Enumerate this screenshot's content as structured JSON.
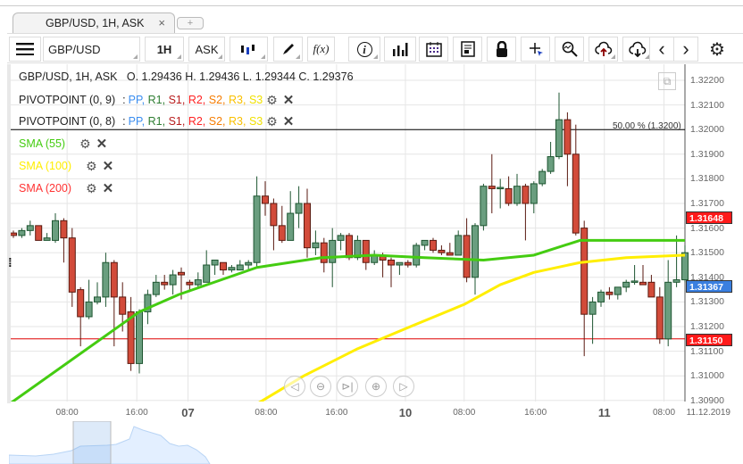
{
  "tab": {
    "title": "GBP/USD, 1H, ASK",
    "close": "×",
    "add": "+"
  },
  "toolbar": {
    "menu": "menu-icon",
    "symbol": "GBP/USD",
    "timeframe": "1H",
    "side": "ASK",
    "fx": "f(x)",
    "info": "i",
    "prev": "‹",
    "next": "›"
  },
  "legend": {
    "ohlc": "GBP/USD, 1H, ASK   O. 1.29436 H. 1.29436 L. 1.29344 C. 1.29376",
    "pivot1": "PIVOTPOINT (0, 9)",
    "pivot2": "PIVOTPOINT (0, 8)",
    "pivot_items": [
      {
        "t": "PP",
        "c": "#3b8ef0"
      },
      {
        "t": "R1",
        "c": "#2e7d32"
      },
      {
        "t": "S1",
        "c": "#b71c1c"
      },
      {
        "t": "R2",
        "c": "#f22"
      },
      {
        "t": "S2",
        "c": "#f57c00"
      },
      {
        "t": "R3",
        "c": "#f9c000"
      },
      {
        "t": "S3",
        "c": "#f0e000"
      }
    ],
    "sma55": "SMA (55)",
    "sma100": "SMA (100)",
    "sma200": "SMA (200)"
  },
  "colors": {
    "sma55": "#44cc11",
    "sma100": "#ffee00",
    "sma200": "#ff3333",
    "up": "#6a9e7f",
    "down": "#d24b3a",
    "bid": "#3a7fe0"
  },
  "annotation": "50.00 % (1.3200)",
  "price_labels": {
    "high": "1.31648",
    "bid": "1.31367",
    "low": "1.31150"
  },
  "chart_data": {
    "type": "candlestick",
    "ylim": [
      1.309,
      1.3225
    ],
    "yticks": [
      "1.32200",
      "1.32100",
      "1.32000",
      "1.31900",
      "1.31800",
      "1.31700",
      "1.31600",
      "1.31500",
      "1.31400",
      "1.31300",
      "1.31200",
      "1.31100",
      "1.31000",
      "1.30900"
    ],
    "xticks": [
      {
        "l": "08:00",
        "i": 6.4,
        "day": false
      },
      {
        "l": "16:00",
        "i": 14.7,
        "day": false
      },
      {
        "l": "07",
        "i": 20.8,
        "day": true
      },
      {
        "l": "08:00",
        "i": 30.1,
        "day": false
      },
      {
        "l": "16:00",
        "i": 38.5,
        "day": false
      },
      {
        "l": "10",
        "i": 46.7,
        "day": true
      },
      {
        "l": "08:00",
        "i": 53.7,
        "day": false
      },
      {
        "l": "16:00",
        "i": 62.2,
        "day": false
      },
      {
        "l": "11",
        "i": 70.4,
        "day": true
      },
      {
        "l": "08:00",
        "i": 77.5,
        "day": false
      },
      {
        "l": "11.12.2019",
        "i": 82.8,
        "day": false
      }
    ],
    "hlines": [
      {
        "price": 1.32,
        "color": "#000"
      },
      {
        "price": 1.3115,
        "color": "#d00"
      }
    ],
    "candles": [
      [
        1.3158,
        1.3159,
        1.3156,
        1.3157
      ],
      [
        1.3157,
        1.316,
        1.3156,
        1.3159
      ],
      [
        1.3159,
        1.3163,
        1.3157,
        1.3161
      ],
      [
        1.3161,
        1.3161,
        1.3155,
        1.3155
      ],
      [
        1.3155,
        1.3158,
        1.3155,
        1.3156
      ],
      [
        1.3155,
        1.3166,
        1.3154,
        1.3163
      ],
      [
        1.3163,
        1.3164,
        1.3146,
        1.3156
      ],
      [
        1.3156,
        1.316,
        1.3128,
        1.3134
      ],
      [
        1.3135,
        1.3136,
        1.3112,
        1.3124
      ],
      [
        1.3124,
        1.3139,
        1.3123,
        1.313
      ],
      [
        1.313,
        1.3138,
        1.3129,
        1.3132
      ],
      [
        1.3132,
        1.315,
        1.3128,
        1.3146
      ],
      [
        1.3146,
        1.3147,
        1.3112,
        1.3132
      ],
      [
        1.3132,
        1.3138,
        1.3118,
        1.3125
      ],
      [
        1.3126,
        1.3132,
        1.3102,
        1.3105
      ],
      [
        1.3105,
        1.3127,
        1.3101,
        1.3126
      ],
      [
        1.3126,
        1.3135,
        1.3121,
        1.3133
      ],
      [
        1.3133,
        1.3141,
        1.3132,
        1.3138
      ],
      [
        1.3138,
        1.3141,
        1.3135,
        1.3137
      ],
      [
        1.3137,
        1.3143,
        1.3133,
        1.3141
      ],
      [
        1.3142,
        1.3144,
        1.3131,
        1.3141
      ],
      [
        1.3138,
        1.3139,
        1.3134,
        1.3137
      ],
      [
        1.3137,
        1.3142,
        1.3136,
        1.3139
      ],
      [
        1.3138,
        1.3151,
        1.3138,
        1.3145
      ],
      [
        1.3145,
        1.3147,
        1.3141,
        1.3147
      ],
      [
        1.3146,
        1.3146,
        1.3141,
        1.3143
      ],
      [
        1.3143,
        1.3145,
        1.3142,
        1.3144
      ],
      [
        1.3143,
        1.3147,
        1.3143,
        1.3145
      ],
      [
        1.3145,
        1.3147,
        1.3143,
        1.3146
      ],
      [
        1.3146,
        1.3181,
        1.3144,
        1.3173
      ],
      [
        1.3173,
        1.3179,
        1.3165,
        1.317
      ],
      [
        1.317,
        1.3172,
        1.3151,
        1.3161
      ],
      [
        1.3161,
        1.3169,
        1.3154,
        1.3155
      ],
      [
        1.3155,
        1.3175,
        1.3155,
        1.3166
      ],
      [
        1.3166,
        1.3177,
        1.316,
        1.317
      ],
      [
        1.317,
        1.3176,
        1.3148,
        1.3152
      ],
      [
        1.3152,
        1.3159,
        1.3149,
        1.3154
      ],
      [
        1.3154,
        1.3156,
        1.3142,
        1.3146
      ],
      [
        1.3146,
        1.316,
        1.3136,
        1.3155
      ],
      [
        1.3155,
        1.3158,
        1.3151,
        1.3157
      ],
      [
        1.3157,
        1.3158,
        1.3147,
        1.3148
      ],
      [
        1.3148,
        1.3157,
        1.3147,
        1.3155
      ],
      [
        1.3155,
        1.3155,
        1.3143,
        1.3146
      ],
      [
        1.3146,
        1.3151,
        1.3145,
        1.3149
      ],
      [
        1.3149,
        1.315,
        1.314,
        1.3147
      ],
      [
        1.3147,
        1.3148,
        1.3136,
        1.3145
      ],
      [
        1.3145,
        1.3146,
        1.3141,
        1.3146
      ],
      [
        1.3146,
        1.3147,
        1.3144,
        1.3145
      ],
      [
        1.3145,
        1.3154,
        1.3144,
        1.3153
      ],
      [
        1.3153,
        1.3155,
        1.3151,
        1.3155
      ],
      [
        1.3155,
        1.3156,
        1.315,
        1.3151
      ],
      [
        1.3151,
        1.3153,
        1.3149,
        1.315
      ],
      [
        1.315,
        1.3154,
        1.3149,
        1.3149
      ],
      [
        1.3149,
        1.3159,
        1.3149,
        1.3157
      ],
      [
        1.3157,
        1.3164,
        1.3138,
        1.314
      ],
      [
        1.314,
        1.3162,
        1.3133,
        1.3161
      ],
      [
        1.3161,
        1.3178,
        1.3159,
        1.3177
      ],
      [
        1.3177,
        1.319,
        1.3166,
        1.3176
      ],
      [
        1.3176,
        1.318,
        1.3168,
        1.31765
      ],
      [
        1.3176,
        1.3181,
        1.3169,
        1.317
      ],
      [
        1.317,
        1.3182,
        1.3169,
        1.3177
      ],
      [
        1.3177,
        1.3178,
        1.3155,
        1.317
      ],
      [
        1.317,
        1.3179,
        1.3166,
        1.3178
      ],
      [
        1.3178,
        1.3184,
        1.3177,
        1.3183
      ],
      [
        1.3183,
        1.3195,
        1.3182,
        1.3189
      ],
      [
        1.3189,
        1.3215,
        1.3188,
        1.3204
      ],
      [
        1.3204,
        1.3207,
        1.3177,
        1.319
      ],
      [
        1.319,
        1.3202,
        1.3157,
        1.3158
      ],
      [
        1.316,
        1.3163,
        1.3108,
        1.3125
      ],
      [
        1.3125,
        1.3132,
        1.3113,
        1.313
      ],
      [
        1.313,
        1.3135,
        1.3128,
        1.3134
      ],
      [
        1.3134,
        1.3136,
        1.3131,
        1.3133
      ],
      [
        1.3133,
        1.3136,
        1.3131,
        1.3136
      ],
      [
        1.3136,
        1.3139,
        1.3134,
        1.3138
      ],
      [
        1.3138,
        1.3145,
        1.3137,
        1.31385
      ],
      [
        1.3138,
        1.3145,
        1.3137,
        1.3137
      ],
      [
        1.3138,
        1.3141,
        1.3132,
        1.3132
      ],
      [
        1.3132,
        1.3136,
        1.3113,
        1.3115
      ],
      [
        1.3115,
        1.3147,
        1.3112,
        1.3138
      ],
      [
        1.3138,
        1.3157,
        1.3136,
        1.3139
      ],
      [
        1.3139,
        1.3153,
        1.3138,
        1.315
      ]
    ],
    "sma55": [
      [
        -0.3,
        1.3089
      ],
      [
        15,
        1.3126
      ],
      [
        19.7,
        1.3133
      ],
      [
        29,
        1.3144
      ],
      [
        36.7,
        1.3148
      ],
      [
        43,
        1.3149
      ],
      [
        49,
        1.3148
      ],
      [
        56,
        1.3147
      ],
      [
        62,
        1.3149
      ],
      [
        67.5,
        1.3155
      ],
      [
        73,
        1.3155
      ],
      [
        78,
        1.3155
      ],
      [
        80.3,
        1.3155
      ]
    ],
    "sma100": [
      [
        29.2,
        1.3089
      ],
      [
        34.6,
        1.31
      ],
      [
        41,
        1.3111
      ],
      [
        47.3,
        1.312
      ],
      [
        53.7,
        1.3129
      ],
      [
        58,
        1.3137
      ],
      [
        62,
        1.3142
      ],
      [
        67.5,
        1.3146
      ],
      [
        73,
        1.3148
      ],
      [
        80.3,
        1.3149
      ]
    ]
  }
}
